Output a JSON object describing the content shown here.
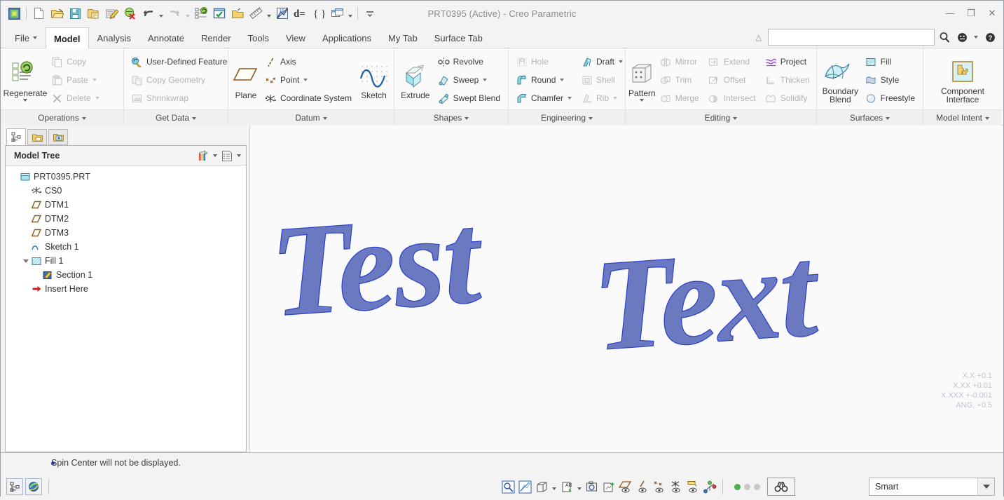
{
  "window": {
    "title": "PRT0395 (Active) - Creo Parametric",
    "minimize": "—",
    "restore": "❐",
    "close": "✕"
  },
  "quick_access": [
    {
      "name": "creo-logo-icon",
      "label": "Creo"
    },
    {
      "name": "new-file-icon",
      "label": "New"
    },
    {
      "name": "open-file-icon",
      "label": "Open"
    },
    {
      "name": "save-icon",
      "label": "Save"
    },
    {
      "name": "save-a-copy-icon",
      "label": "Save a Copy"
    },
    {
      "name": "edit-note-icon",
      "label": "Edit"
    },
    {
      "name": "close-window-icon",
      "label": "Close"
    },
    {
      "name": "undo-icon",
      "label": "Undo"
    },
    {
      "name": "redo-icon",
      "label": "Redo"
    },
    {
      "name": "regenerate-icon",
      "label": "Regenerate"
    },
    {
      "name": "checked-window-icon",
      "label": "Window"
    },
    {
      "name": "open-folder-icon",
      "label": "Browser"
    },
    {
      "name": "measure-icon",
      "label": "Measure"
    },
    {
      "name": "analysis-icon",
      "label": "Analysis"
    },
    {
      "name": "parameters-icon",
      "label": "Parameters"
    },
    {
      "name": "relations-icon",
      "label": "Relations"
    },
    {
      "name": "window-switch-icon",
      "label": "Switch Window"
    },
    {
      "name": "qat-overflow-icon",
      "label": "More"
    }
  ],
  "tabs": [
    {
      "label": "File",
      "active": false,
      "has_caret": true
    },
    {
      "label": "Model",
      "active": true,
      "has_caret": false
    },
    {
      "label": "Analysis",
      "active": false,
      "has_caret": false
    },
    {
      "label": "Annotate",
      "active": false,
      "has_caret": false
    },
    {
      "label": "Render",
      "active": false,
      "has_caret": false
    },
    {
      "label": "Tools",
      "active": false,
      "has_caret": false
    },
    {
      "label": "View",
      "active": false,
      "has_caret": false
    },
    {
      "label": "Applications",
      "active": false,
      "has_caret": false
    },
    {
      "label": "My Tab",
      "active": false,
      "has_caret": false
    },
    {
      "label": "Surface Tab",
      "active": false,
      "has_caret": false
    }
  ],
  "search": {
    "value": "",
    "placeholder": "",
    "search_icon": "search-icon",
    "help_icon": "help-icon",
    "options_icon": "help-options-icon"
  },
  "ribbon": {
    "groups": [
      {
        "label": "Operations",
        "big": {
          "label": "Regenerate",
          "icon": "regenerate-icon",
          "caret": true
        },
        "columns": [
          [
            {
              "label": "Copy",
              "icon": "copy-icon",
              "disabled": true,
              "caret": false
            },
            {
              "label": "Paste",
              "icon": "paste-icon",
              "disabled": true,
              "caret": true
            },
            {
              "label": "Delete",
              "icon": "delete-icon",
              "disabled": true,
              "caret": true
            }
          ]
        ]
      },
      {
        "label": "Get Data",
        "big": null,
        "columns": [
          [
            {
              "label": "User-Defined Feature",
              "icon": "udf-icon",
              "disabled": false,
              "caret": false
            },
            {
              "label": "Copy Geometry",
              "icon": "copy-geometry-icon",
              "disabled": true,
              "caret": false
            },
            {
              "label": "Shrinkwrap",
              "icon": "shrinkwrap-icon",
              "disabled": true,
              "caret": false
            }
          ]
        ]
      },
      {
        "label": "Datum",
        "big": {
          "label": "Plane",
          "icon": "plane-icon",
          "caret": false
        },
        "columns": [
          [
            {
              "label": "Axis",
              "icon": "axis-icon",
              "disabled": false,
              "caret": false
            },
            {
              "label": "Point",
              "icon": "point-icon",
              "disabled": false,
              "caret": true
            },
            {
              "label": "Coordinate System",
              "icon": "coordinate-system-icon",
              "disabled": false,
              "caret": false
            }
          ]
        ],
        "big_right": {
          "label": "Sketch",
          "icon": "sketch-icon",
          "caret": false
        }
      },
      {
        "label": "Shapes",
        "big": {
          "label": "Extrude",
          "icon": "extrude-icon",
          "caret": false
        },
        "columns": [
          [
            {
              "label": "Revolve",
              "icon": "revolve-icon",
              "disabled": false,
              "caret": false
            },
            {
              "label": "Sweep",
              "icon": "sweep-icon",
              "disabled": false,
              "caret": true
            },
            {
              "label": "Swept Blend",
              "icon": "swept-blend-icon",
              "disabled": false,
              "caret": false
            }
          ]
        ]
      },
      {
        "label": "Engineering",
        "big": null,
        "columns": [
          [
            {
              "label": "Hole",
              "icon": "hole-icon",
              "disabled": true,
              "caret": false
            },
            {
              "label": "Round",
              "icon": "round-icon",
              "disabled": false,
              "caret": true
            },
            {
              "label": "Chamfer",
              "icon": "chamfer-icon",
              "disabled": false,
              "caret": true
            }
          ],
          [
            {
              "label": "Draft",
              "icon": "draft-icon",
              "disabled": false,
              "caret": true
            },
            {
              "label": "Shell",
              "icon": "shell-icon",
              "disabled": true,
              "caret": false
            },
            {
              "label": "Rib",
              "icon": "rib-icon",
              "disabled": true,
              "caret": true
            }
          ]
        ]
      },
      {
        "label": "Editing",
        "big": {
          "label": "Pattern",
          "icon": "pattern-icon",
          "caret": true
        },
        "columns": [
          [
            {
              "label": "Mirror",
              "icon": "mirror-icon",
              "disabled": true,
              "caret": false
            },
            {
              "label": "Trim",
              "icon": "trim-icon",
              "disabled": true,
              "caret": false
            },
            {
              "label": "Merge",
              "icon": "merge-icon",
              "disabled": true,
              "caret": false
            }
          ],
          [
            {
              "label": "Extend",
              "icon": "extend-icon",
              "disabled": true,
              "caret": false
            },
            {
              "label": "Offset",
              "icon": "offset-icon",
              "disabled": true,
              "caret": false
            },
            {
              "label": "Intersect",
              "icon": "intersect-icon",
              "disabled": true,
              "caret": false
            }
          ],
          [
            {
              "label": "Project",
              "icon": "project-icon",
              "disabled": false,
              "caret": false
            },
            {
              "label": "Thicken",
              "icon": "thicken-icon",
              "disabled": true,
              "caret": false
            },
            {
              "label": "Solidify",
              "icon": "solidify-icon",
              "disabled": true,
              "caret": false
            }
          ]
        ]
      },
      {
        "label": "Surfaces",
        "big": {
          "label": "Boundary\nBlend",
          "icon": "boundary-blend-icon",
          "caret": false
        },
        "columns": [
          [
            {
              "label": "Fill",
              "icon": "fill-icon",
              "disabled": false,
              "caret": false
            },
            {
              "label": "Style",
              "icon": "style-icon",
              "disabled": false,
              "caret": false
            },
            {
              "label": "Freestyle",
              "icon": "freestyle-icon",
              "disabled": false,
              "caret": false
            }
          ]
        ]
      },
      {
        "label": "Model Intent",
        "big": {
          "label": "Component\nInterface",
          "icon": "component-interface-icon",
          "caret": false
        },
        "columns": []
      }
    ]
  },
  "navigator": {
    "tabs": [
      {
        "name": "model-tree-tab",
        "label": "Model Tree",
        "active": true
      },
      {
        "name": "folder-browser-tab",
        "label": "Folder Browser",
        "active": false
      },
      {
        "name": "favorites-tab",
        "label": "Favorites",
        "active": false
      }
    ],
    "panel_title": "Model Tree",
    "header_buttons": [
      {
        "name": "tree-filters-icon",
        "label": "Settings"
      },
      {
        "name": "tree-columns-icon",
        "label": "Display"
      }
    ],
    "tree": [
      {
        "label": "PRT0395.PRT",
        "icon": "part-icon",
        "indent": 0,
        "expander": ""
      },
      {
        "label": "CS0",
        "icon": "coordinate-system-icon",
        "indent": 1,
        "expander": ""
      },
      {
        "label": "DTM1",
        "icon": "datum-plane-icon",
        "indent": 1,
        "expander": ""
      },
      {
        "label": "DTM2",
        "icon": "datum-plane-icon",
        "indent": 1,
        "expander": ""
      },
      {
        "label": "DTM3",
        "icon": "datum-plane-icon",
        "indent": 1,
        "expander": ""
      },
      {
        "label": "Sketch 1",
        "icon": "sketch-feature-icon",
        "indent": 1,
        "expander": ""
      },
      {
        "label": "Fill 1",
        "icon": "fill-feature-icon",
        "indent": 1,
        "expander": "collapse"
      },
      {
        "label": "Section 1",
        "icon": "section-icon",
        "indent": 2,
        "expander": ""
      },
      {
        "label": "Insert Here",
        "icon": "insert-here-icon",
        "indent": 1,
        "expander": ""
      }
    ]
  },
  "graphics": {
    "model_words": [
      {
        "text": "Test",
        "name": "model-text-test"
      },
      {
        "text": "Text",
        "name": "model-text-text"
      }
    ],
    "geometry_color": "#6b7ac0",
    "edge_color": "#2a3ecb",
    "background": "#fafafa",
    "tolerance_lines": [
      "X.X +0.1",
      "X.XX +0.01",
      "X.XXX +-0.001",
      "ANG. +0.5"
    ]
  },
  "status": {
    "message": "Spin Center will not be displayed.",
    "left_buttons": [
      {
        "name": "model-tree-toggle-icon",
        "label": "Model Tree"
      },
      {
        "name": "browser-toggle-icon",
        "label": "Web Browser"
      }
    ],
    "view_tools": [
      {
        "name": "zoom-in-icon",
        "label": "Zoom In",
        "caret": false
      },
      {
        "name": "refit-icon",
        "label": "Refit",
        "caret": false
      },
      {
        "name": "display-style-icon",
        "label": "Display Style",
        "caret": true
      },
      {
        "name": "saved-orientations-icon",
        "label": "Saved Orientations",
        "caret": true
      },
      {
        "name": "view-manager-icon",
        "label": "View Manager",
        "caret": false
      },
      {
        "name": "appearance-icon",
        "label": "Appearance Gallery",
        "caret": false
      },
      {
        "name": "plane-display-icon",
        "label": "Plane Display",
        "caret": false
      },
      {
        "name": "axis-display-icon",
        "label": "Axis Display",
        "caret": false
      },
      {
        "name": "point-display-icon",
        "label": "Point Display",
        "caret": false
      },
      {
        "name": "csys-display-icon",
        "label": "Csys Display",
        "caret": false
      },
      {
        "name": "annotation-display-icon",
        "label": "Annotation Display",
        "caret": false
      },
      {
        "name": "spin-center-icon",
        "label": "Spin Center",
        "caret": false
      }
    ],
    "leds": [
      "#4caf50",
      "#c8c8c8",
      "#c8c8c8"
    ],
    "search_button": {
      "name": "find-icon",
      "label": "Find"
    },
    "selection_filter": {
      "value": "Smart",
      "name": "selection-filter-select"
    }
  }
}
